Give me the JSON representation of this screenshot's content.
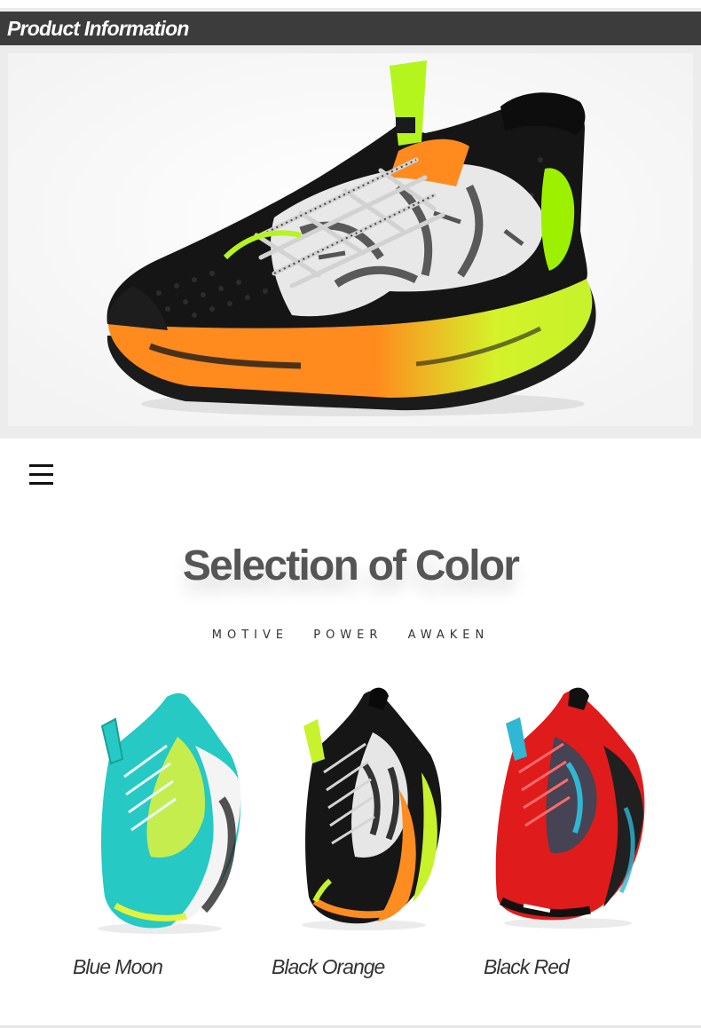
{
  "header": {
    "title": "Product Information"
  },
  "hero": {
    "image_subject": "black-orange-neon-basketball-shoe",
    "colors": {
      "upper": "#151515",
      "sole_orange": "#ff8a1e",
      "sole_green": "#c6f22a",
      "accent_green": "#9cf000",
      "tiedye_white": "#e8e8e8",
      "laces": "#cfcfcf"
    }
  },
  "menu": {
    "icon": "hamburger-menu-icon"
  },
  "colors_section": {
    "title": "Selection of Color",
    "subtitle_words": [
      "MOTIVE",
      "POWER",
      "AWAKEN"
    ],
    "options": [
      {
        "label": "Blue Moon",
        "colors": {
          "upper": "#26c9c3",
          "accent": "#e3f33a",
          "sole": "#f4f4f4",
          "dark": "#1b1b1b"
        }
      },
      {
        "label": "Black Orange",
        "colors": {
          "upper": "#161616",
          "accent": "#ff8c1f",
          "sole": "#c7f22c",
          "dark": "#0a0a0a"
        }
      },
      {
        "label": "Black Red",
        "colors": {
          "upper": "#e01b1b",
          "accent": "#2fb7d3",
          "sole": "#202020",
          "dark": "#111111"
        }
      }
    ]
  }
}
